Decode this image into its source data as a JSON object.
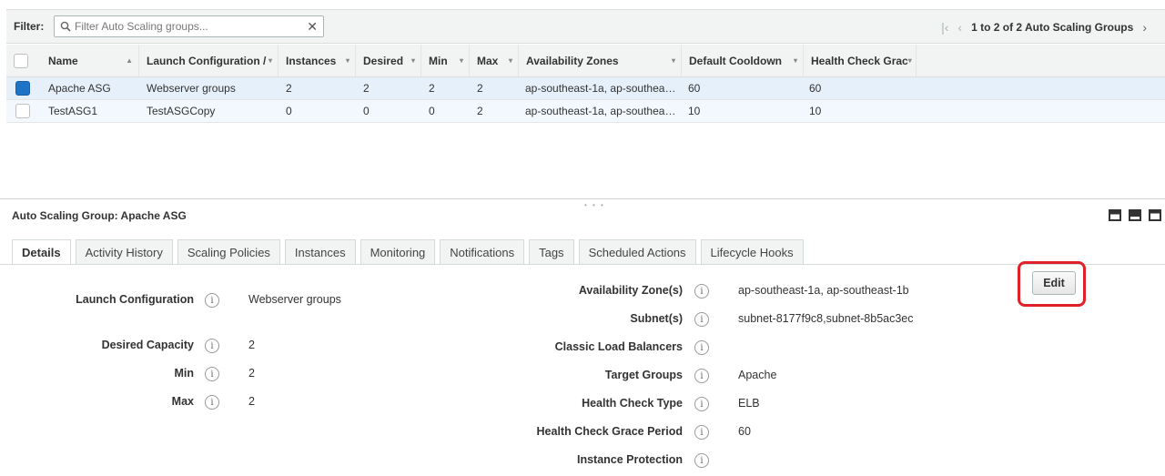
{
  "filter": {
    "label": "Filter:",
    "placeholder": "Filter Auto Scaling groups...",
    "clear_glyph": "✕",
    "search_icon": "search-icon"
  },
  "pager": {
    "first_glyph": "|‹",
    "prev_glyph": "‹",
    "text": "1 to 2 of 2 Auto Scaling Groups",
    "next_glyph": "›",
    "last_glyph": "›|"
  },
  "table": {
    "headers": [
      "Name",
      "Launch Configuration /",
      "Instances",
      "Desired",
      "Min",
      "Max",
      "Availability Zones",
      "Default Cooldown",
      "Health Check Grac"
    ],
    "sort_glyph": "▲",
    "menu_glyph": "▾",
    "rows": [
      {
        "selected": true,
        "name": "Apache ASG",
        "launch_config": "Webserver groups",
        "instances": "2",
        "desired": "2",
        "min": "2",
        "max": "2",
        "zones": "ap-southeast-1a, ap-southea…",
        "cooldown": "60",
        "grace": "60"
      },
      {
        "selected": false,
        "name": "TestASG1",
        "launch_config": "TestASGCopy",
        "instances": "0",
        "desired": "0",
        "min": "0",
        "max": "2",
        "zones": "ap-southeast-1a, ap-southea…",
        "cooldown": "10",
        "grace": "10"
      }
    ]
  },
  "detail": {
    "grip": "• • •",
    "title": "Auto Scaling Group: Apache ASG",
    "tabs": [
      "Details",
      "Activity History",
      "Scaling Policies",
      "Instances",
      "Monitoring",
      "Notifications",
      "Tags",
      "Scheduled Actions",
      "Lifecycle Hooks"
    ],
    "info_glyph": "i",
    "left_fields": {
      "launch_config_label": "Launch Configuration",
      "launch_config_value": "Webserver groups",
      "desired_label": "Desired Capacity",
      "desired_value": "2",
      "min_label": "Min",
      "min_value": "2",
      "max_label": "Max",
      "max_value": "2"
    },
    "right_fields": {
      "az_label": "Availability Zone(s)",
      "az_value": "ap-southeast-1a, ap-southeast-1b",
      "subnet_label": "Subnet(s)",
      "subnet_value": "subnet-8177f9c8,subnet-8b5ac3ec",
      "clb_label": "Classic Load Balancers",
      "clb_value": "",
      "tg_label": "Target Groups",
      "tg_value": "Apache",
      "hct_label": "Health Check Type",
      "hct_value": "ELB",
      "hcgp_label": "Health Check Grace Period",
      "hcgp_value": "60",
      "ip_label": "Instance Protection",
      "ip_value": ""
    },
    "edit_label": "Edit",
    "highlight_color": "#e0202a"
  }
}
